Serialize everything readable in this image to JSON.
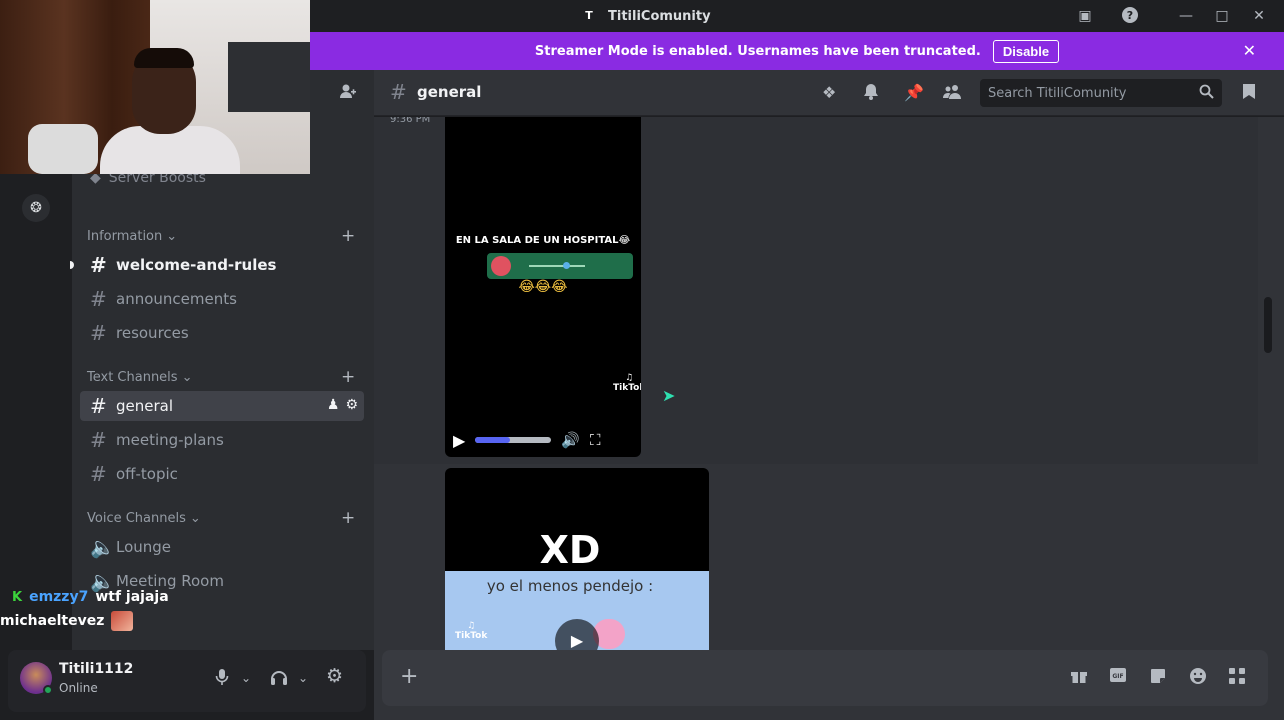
{
  "window": {
    "title": "TitiliComunity",
    "badge": "T",
    "icons": [
      "inbox-icon",
      "help-icon",
      "minimize-icon",
      "maximize-icon",
      "close-icon"
    ]
  },
  "banner": {
    "text": "Streamer Mode is enabled. Usernames have been truncated.",
    "button": "Disable"
  },
  "sidebar": {
    "boosts": "Server Boosts",
    "categories": [
      {
        "name": "Information"
      },
      {
        "name": "Text Channels"
      },
      {
        "name": "Voice Channels"
      }
    ],
    "channels": [
      {
        "name": "welcome-and-rules",
        "state": "unread"
      },
      {
        "name": "announcements"
      },
      {
        "name": "resources"
      },
      {
        "name": "general",
        "state": "active"
      },
      {
        "name": "meeting-plans"
      },
      {
        "name": "off-topic"
      },
      {
        "name": "Lounge",
        "type": "voice"
      },
      {
        "name": "Meeting Room",
        "type": "voice"
      }
    ]
  },
  "overlay_chat": [
    {
      "user": "emzzy7",
      "message": "wtf jajaja"
    },
    {
      "user": "michaeltevez",
      "message": ""
    }
  ],
  "user": {
    "name": "Titili1112",
    "status": "Online"
  },
  "header": {
    "channel": "general",
    "search_placeholder": "Search TitiliComunity"
  },
  "messages": {
    "timestamp": "9:36 PM",
    "video1": {
      "caption": "EN LA SALA DE UN HOSPITAL😂",
      "emoji": "😂😂😂",
      "tiktok": "TikTok",
      "progress": 0.45
    },
    "video2": {
      "big_text": "XD",
      "caption": "yo el menos pendejo :",
      "tiktok": "TikTok"
    }
  },
  "composer": {
    "placeholder": ""
  }
}
